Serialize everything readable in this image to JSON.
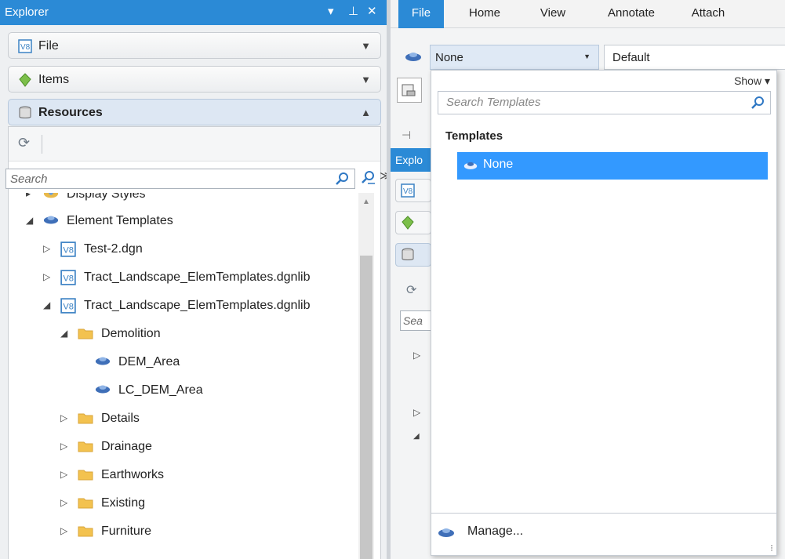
{
  "explorer": {
    "title": "Explorer",
    "controls": {
      "menu": "▾",
      "pin": "⊥",
      "close": "✕"
    },
    "sections": {
      "file": "File",
      "items": "Items",
      "resources": "Resources"
    },
    "search_placeholder": "Search",
    "extra_toggle": "≫",
    "tree": [
      {
        "label": "Display Styles",
        "twist": "▸",
        "icon": "display-styles-icon"
      },
      {
        "label": "Element Templates",
        "twist": "◢",
        "icon": "element-template-icon"
      },
      {
        "label": "Test-2.dgn",
        "twist": "▷",
        "icon": "v8-file-icon"
      },
      {
        "label": "Tract_Landscape_ElemTemplates.dgnlib",
        "twist": "▷",
        "icon": "v8-file-icon"
      },
      {
        "label": "Tract_Landscape_ElemTemplates.dgnlib",
        "twist": "◢",
        "icon": "v8-file-icon"
      },
      {
        "label": "Demolition",
        "twist": "◢",
        "icon": "folder-icon"
      },
      {
        "label": "DEM_Area",
        "twist": "",
        "icon": "element-template-icon"
      },
      {
        "label": "LC_DEM_Area",
        "twist": "",
        "icon": "element-template-icon"
      },
      {
        "label": "Details",
        "twist": "▷",
        "icon": "folder-icon"
      },
      {
        "label": "Drainage",
        "twist": "▷",
        "icon": "folder-icon"
      },
      {
        "label": "Earthworks",
        "twist": "▷",
        "icon": "folder-icon"
      },
      {
        "label": "Existing",
        "twist": "▷",
        "icon": "folder-icon"
      },
      {
        "label": "Furniture",
        "twist": "▷",
        "icon": "folder-icon"
      }
    ]
  },
  "ribbon": {
    "tabs": [
      "File",
      "Home",
      "View",
      "Annotate",
      "Attach"
    ]
  },
  "template_combo": {
    "value": "None",
    "arrow": "▼"
  },
  "level_combo": {
    "value": "Default"
  },
  "background_panel": {
    "title_fragment": "Explo",
    "search_fragment": "Sea"
  },
  "dropdown": {
    "show_label": "Show ▾",
    "search_placeholder": "Search Templates",
    "heading": "Templates",
    "items": [
      "None"
    ],
    "footer": "Manage..."
  },
  "colors": {
    "accent": "#2b8ad6",
    "selection": "#3399ff",
    "template_icon": "#3f6fb8",
    "folder": "#f3c24f"
  }
}
